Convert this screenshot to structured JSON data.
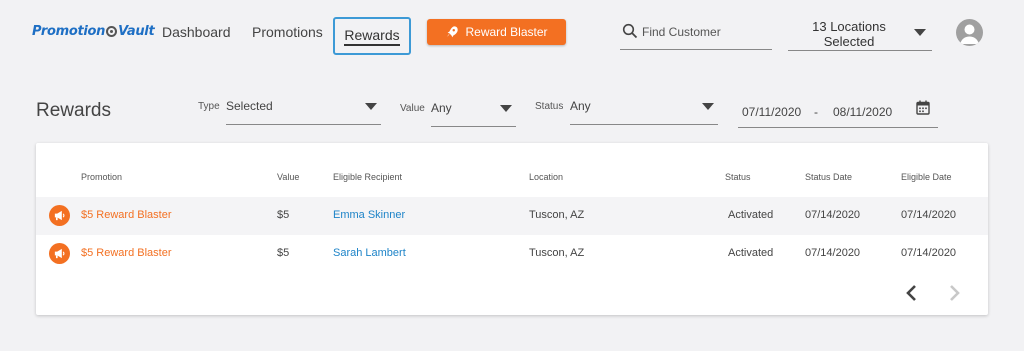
{
  "header": {
    "logo_part1": "Promotion",
    "logo_part2": "Vault",
    "nav": {
      "dashboard": "Dashboard",
      "promotions": "Promotions",
      "rewards": "Rewards"
    },
    "reward_blaster_label": "Reward Blaster",
    "search_placeholder": "Find Customer",
    "locations": {
      "line1": "13 Locations",
      "line2": "Selected"
    }
  },
  "page": {
    "title": "Rewards",
    "filters": {
      "type_label": "Type",
      "type_value": "Selected",
      "value_label": "Value",
      "value_value": "Any",
      "status_label": "Status",
      "status_value": "Any",
      "date_from": "07/11/2020",
      "date_sep": "-",
      "date_to": "08/11/2020"
    }
  },
  "table": {
    "columns": [
      "Promotion",
      "Value",
      "Eligible Recipient",
      "Location",
      "Status",
      "Status Date",
      "Eligible Date"
    ],
    "rows": [
      {
        "promotion": "$5 Reward Blaster",
        "value": "$5",
        "recipient": "Emma Skinner",
        "location": "Tuscon, AZ",
        "status": "Activated",
        "status_date": "07/14/2020",
        "eligible_date": "07/14/2020"
      },
      {
        "promotion": "$5 Reward Blaster",
        "value": "$5",
        "recipient": "Sarah Lambert",
        "location": "Tuscon, AZ",
        "status": "Activated",
        "status_date": "07/14/2020",
        "eligible_date": "07/14/2020"
      }
    ]
  },
  "colors": {
    "accent_orange": "#f37022",
    "link_blue": "#1e84c8",
    "active_border": "#3d9ad6"
  },
  "icons": {
    "search": "search-icon",
    "calendar": "calendar-icon",
    "rocket": "rocket-icon",
    "megaphone": "megaphone-icon",
    "avatar": "user-avatar-icon",
    "prev": "chevron-left-icon",
    "next": "chevron-right-icon"
  }
}
